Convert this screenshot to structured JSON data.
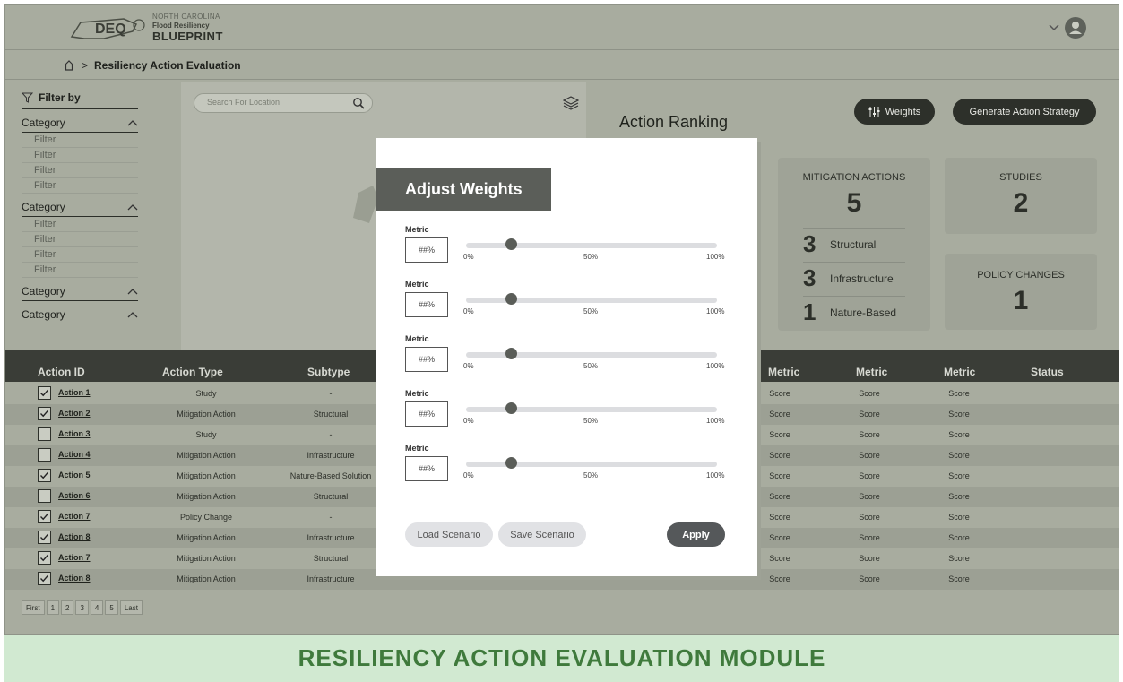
{
  "header": {
    "logo_abbr": "DEQ",
    "logo_line1": "NORTH CAROLINA",
    "logo_line2": "Flood Resiliency",
    "logo_line3": "BLUEPRINT"
  },
  "breadcrumb": {
    "current": "Resiliency Action Evaluation"
  },
  "filter": {
    "title": "Filter by",
    "groups": [
      {
        "label": "Category",
        "items": [
          "Filter",
          "Filter",
          "Filter",
          "Filter"
        ]
      },
      {
        "label": "Category",
        "items": [
          "Filter",
          "Filter",
          "Filter",
          "Filter"
        ]
      },
      {
        "label": "Category",
        "items": []
      },
      {
        "label": "Category",
        "items": []
      }
    ]
  },
  "map": {
    "search_placeholder": "Search For Location"
  },
  "ranking": {
    "title": "Action Ranking",
    "weights_label": "Weights",
    "generate_label": "Generate Action Strategy",
    "mitigation_label": "MITIGATION ACTIONS",
    "mitigation_count": "5",
    "subcounts": [
      {
        "count": "3",
        "label": "Structural"
      },
      {
        "count": "3",
        "label": "Infrastructure"
      },
      {
        "count": "1",
        "label": "Nature-Based"
      }
    ],
    "studies_label": "STUDIES",
    "studies_count": "2",
    "policy_label": "POLICY CHANGES",
    "policy_count": "1"
  },
  "table": {
    "headers": {
      "action_id": "Action ID",
      "action_type": "Action Type",
      "subtype": "Subtype",
      "metric1": "Metric",
      "metric2": "Metric",
      "metric3": "Metric",
      "status": "Status"
    },
    "rows": [
      {
        "checked": true,
        "id": "Action 1",
        "type": "Study",
        "subtype": "-",
        "s1": "Score",
        "s2": "Score",
        "s3": "Score"
      },
      {
        "checked": true,
        "id": "Action 2",
        "type": "Mitigation Action",
        "subtype": "Structural",
        "s1": "Score",
        "s2": "Score",
        "s3": "Score"
      },
      {
        "checked": false,
        "id": "Action 3",
        "type": "Study",
        "subtype": "-",
        "s1": "Score",
        "s2": "Score",
        "s3": "Score"
      },
      {
        "checked": false,
        "id": "Action 4",
        "type": "Mitigation Action",
        "subtype": "Infrastructure",
        "s1": "Score",
        "s2": "Score",
        "s3": "Score"
      },
      {
        "checked": true,
        "id": "Action 5",
        "type": "Mitigation Action",
        "subtype": "Nature-Based Solution",
        "s1": "Score",
        "s2": "Score",
        "s3": "Score"
      },
      {
        "checked": false,
        "id": "Action 6",
        "type": "Mitigation Action",
        "subtype": "Structural",
        "s1": "Score",
        "s2": "Score",
        "s3": "Score"
      },
      {
        "checked": true,
        "id": "Action 7",
        "type": "Policy Change",
        "subtype": "-",
        "s1": "Score",
        "s2": "Score",
        "s3": "Score"
      },
      {
        "checked": true,
        "id": "Action 8",
        "type": "Mitigation Action",
        "subtype": "Infrastructure",
        "s1": "Score",
        "s2": "Score",
        "s3": "Score"
      },
      {
        "checked": true,
        "id": "Action 7",
        "type": "Mitigation Action",
        "subtype": "Structural",
        "s1": "Score",
        "s2": "Score",
        "s3": "Score"
      },
      {
        "checked": true,
        "id": "Action 8",
        "type": "Mitigation Action",
        "subtype": "Infrastructure",
        "s1": "Score",
        "s2": "Score",
        "s3": "Score"
      }
    ]
  },
  "pagination": [
    "First",
    "1",
    "2",
    "3",
    "4",
    "5",
    "Last"
  ],
  "modal": {
    "title": "Adjust Weights",
    "metrics": [
      {
        "label": "Metric",
        "value": "##%",
        "weight": 0.18
      },
      {
        "label": "Metric",
        "value": "##%",
        "weight": 0.18
      },
      {
        "label": "Metric",
        "value": "##%",
        "weight": 0.18
      },
      {
        "label": "Metric",
        "value": "##%",
        "weight": 0.18
      },
      {
        "label": "Metric",
        "value": "##%",
        "weight": 0.18
      }
    ],
    "ticks": [
      "0%",
      "50%",
      "100%"
    ],
    "load_label": "Load Scenario",
    "save_label": "Save Scenario",
    "apply_label": "Apply"
  },
  "footer": {
    "banner": "RESILIENCY ACTION EVALUATION MODULE"
  },
  "colors": {
    "overlay_bg": "#a8ac9f",
    "dark_button": "#2d302a",
    "banner_bg": "#d1e9d1",
    "banner_text": "#3f7a3c",
    "modal_title_bg": "#5b5e59"
  }
}
